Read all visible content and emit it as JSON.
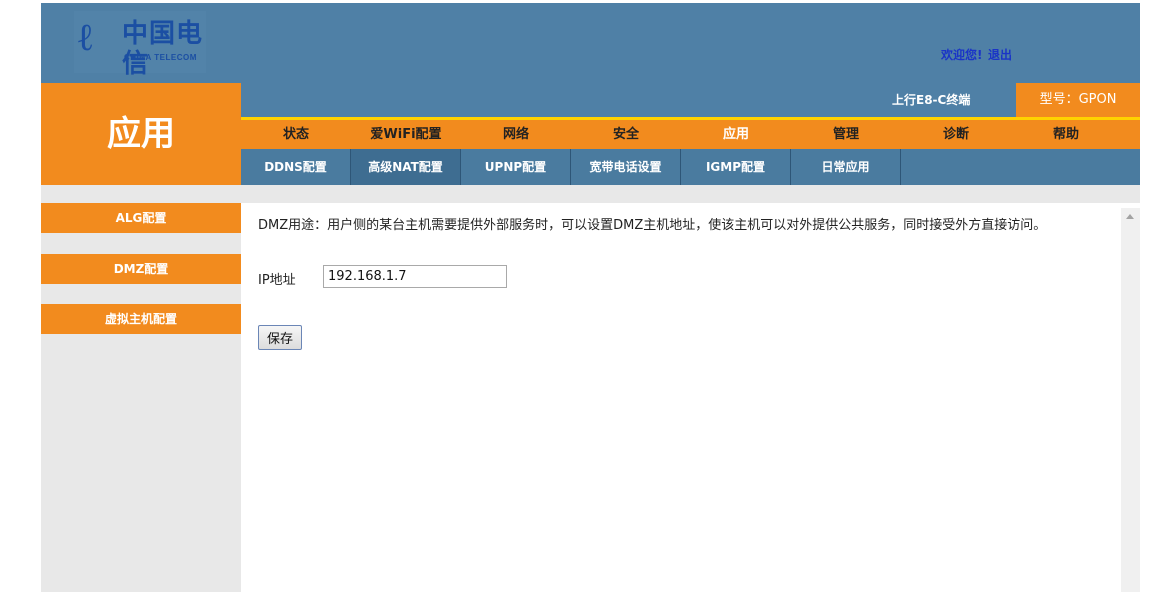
{
  "header": {
    "logo_glyph": "ℓ",
    "logo_cn": "中国电信",
    "logo_en": "CHINA TELECOM",
    "welcome": "欢迎您!",
    "logout": "退出"
  },
  "page_title": "应用",
  "device": {
    "label": "上行E8-C终端",
    "model": "型号：GPON"
  },
  "main_nav": [
    {
      "label": "状态"
    },
    {
      "label": "爱WiFi配置"
    },
    {
      "label": "网络"
    },
    {
      "label": "安全"
    },
    {
      "label": "应用",
      "active": true
    },
    {
      "label": "管理"
    },
    {
      "label": "诊断"
    },
    {
      "label": "帮助"
    }
  ],
  "sub_nav": [
    {
      "label": "DDNS配置"
    },
    {
      "label": "高级NAT配置",
      "active": true
    },
    {
      "label": "UPNP配置"
    },
    {
      "label": "宽带电话设置"
    },
    {
      "label": "IGMP配置"
    },
    {
      "label": "日常应用"
    }
  ],
  "sidebar": {
    "items": [
      {
        "label": "ALG配置"
      },
      {
        "label": "DMZ配置",
        "active": true
      },
      {
        "label": "虚拟主机配置"
      }
    ]
  },
  "content": {
    "description": "DMZ用途：用户侧的某台主机需要提供外部服务时，可以设置DMZ主机地址，使该主机可以对外提供公共服务，同时接受外方直接访问。",
    "ip_label": "IP地址",
    "ip_value": "192.168.1.7",
    "save_label": "保存"
  },
  "colors": {
    "header_blue": "#4f80a6",
    "accent_orange": "#f28b1e",
    "nav_border_yellow": "#ffd200",
    "sidebar_gray": "#e8e8e8"
  },
  "icons": {
    "logo": "china-telecom-logo",
    "scroll_up": "scroll-up-arrow-icon"
  }
}
